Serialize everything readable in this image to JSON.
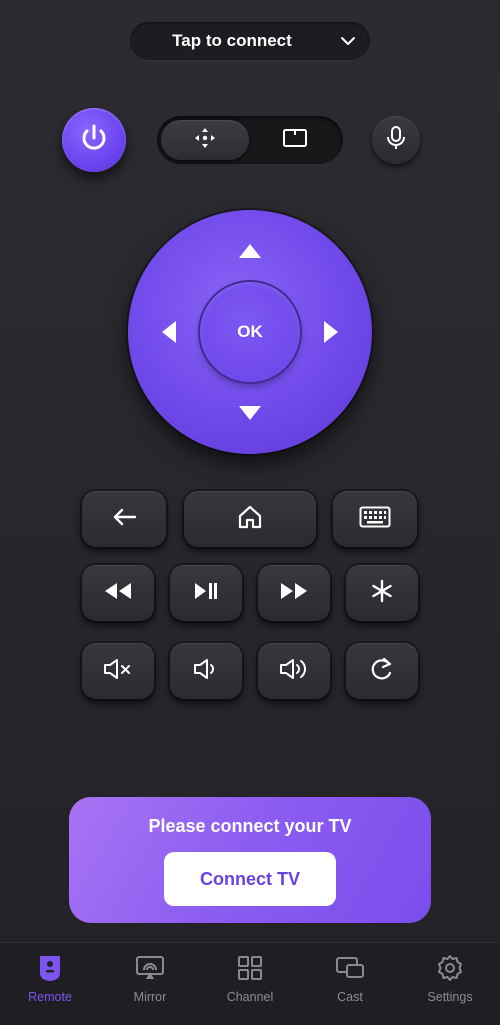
{
  "header": {
    "connect_label": "Tap to connect"
  },
  "remote": {
    "ok_label": "OK"
  },
  "banner": {
    "title": "Please connect your TV",
    "button_label": "Connect TV"
  },
  "tabs": [
    {
      "label": "Remote",
      "icon": "remote-icon",
      "active": true
    },
    {
      "label": "Mirror",
      "icon": "mirror-icon",
      "active": false
    },
    {
      "label": "Channel",
      "icon": "channel-icon",
      "active": false
    },
    {
      "label": "Cast",
      "icon": "cast-icon",
      "active": false
    },
    {
      "label": "Settings",
      "icon": "settings-icon",
      "active": false
    }
  ],
  "colors": {
    "accent": "#6c44ee",
    "background": "#232327",
    "tab_inactive": "#8a8a92"
  }
}
